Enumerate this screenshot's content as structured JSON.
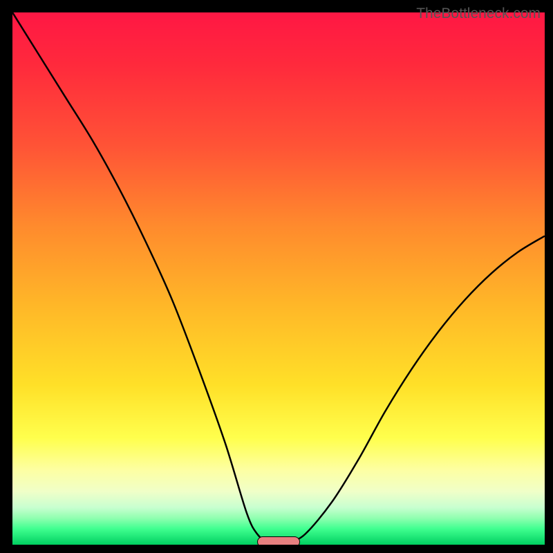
{
  "watermark": "TheBottleneck.com",
  "chart_data": {
    "type": "line",
    "title": "",
    "xlabel": "",
    "ylabel": "",
    "xlim": [
      0,
      100
    ],
    "ylim": [
      0,
      100
    ],
    "series": [
      {
        "name": "bottleneck-curve",
        "x": [
          0,
          5,
          10,
          15,
          20,
          25,
          30,
          35,
          40,
          44,
          46,
          48,
          50,
          52,
          55,
          60,
          65,
          70,
          75,
          80,
          85,
          90,
          95,
          100
        ],
        "values": [
          100,
          92,
          84,
          76,
          67,
          57,
          46,
          33,
          19,
          6,
          2,
          0.5,
          0,
          0.5,
          2,
          8,
          16,
          25,
          33,
          40,
          46,
          51,
          55,
          58
        ]
      }
    ],
    "marker": {
      "x": 50,
      "y": 0,
      "label": "optimal-point"
    },
    "background_gradient": {
      "top_color": "#ff1744",
      "mid_color": "#ffe028",
      "bottom_color": "#00d060",
      "meaning": "red=high bottleneck, green=balanced"
    }
  }
}
